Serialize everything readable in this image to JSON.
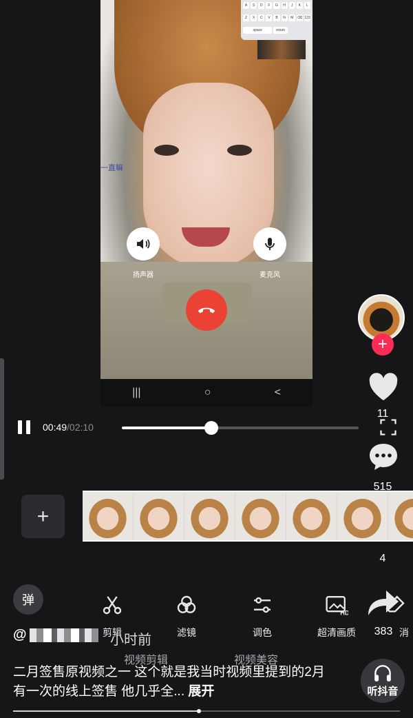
{
  "video": {
    "call": {
      "speaker_label": "扬声器",
      "mic_label": "麦克风",
      "side_text": "一直嘛"
    },
    "keyboard_keys": [
      "A",
      "S",
      "D",
      "F",
      "G",
      "H",
      "J",
      "K",
      "L",
      "Z",
      "X",
      "C",
      "V",
      "B",
      "N",
      "M",
      "⌫",
      "123",
      "space",
      "return"
    ],
    "android_nav": [
      "|||",
      "○",
      "<"
    ]
  },
  "player": {
    "current_time": "00:49",
    "total_time": "/02:10",
    "progress": 0.3769
  },
  "rail": {
    "likes": "11",
    "comments": "515",
    "favorites": "4",
    "shares": "383"
  },
  "toolbar": {
    "danmu_label": "弹",
    "tools": [
      {
        "label": "剪辑"
      },
      {
        "label": "滤镜"
      },
      {
        "label": "调色"
      },
      {
        "label": "超清画质"
      },
      {
        "label": "消"
      }
    ]
  },
  "post": {
    "author_prefix": "@",
    "time_ago": "小时前",
    "ghost_left": "视频剪辑",
    "ghost_right": "视频美容",
    "caption": "二月签售原视频之一 这个就是我当时视频里提到的2月有一次的线上签售 他几乎全...",
    "expand": "展开",
    "listen_label": "听抖音"
  },
  "bottom_progress": 0.48,
  "colors": {
    "background": "#161619",
    "accent_red": "#fe2c55",
    "hangup_red": "#ea4335"
  }
}
